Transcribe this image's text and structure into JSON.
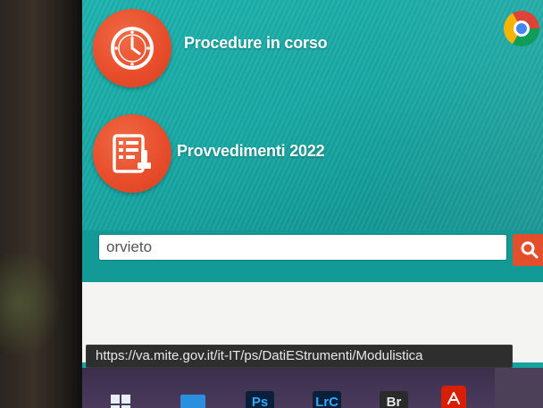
{
  "menu": {
    "items": [
      {
        "label": "Procedure in corso",
        "icon": "clock-icon"
      },
      {
        "label": "Provvedimenti 2022",
        "icon": "document-stamp-icon"
      }
    ]
  },
  "search": {
    "value": "orvieto",
    "button_icon": "search-icon"
  },
  "status_bar": {
    "url": "https://va.mite.gov.it/it-IT/ps/DatiEStrumenti/Modulistica"
  },
  "taskbar": {
    "apps": [
      {
        "name": "windows-start",
        "label": ""
      },
      {
        "name": "file-explorer",
        "label": ""
      },
      {
        "name": "photoshop",
        "label": "Ps"
      },
      {
        "name": "lightroom-classic",
        "label": "LrC"
      },
      {
        "name": "bridge",
        "label": "Br"
      },
      {
        "name": "acrobat",
        "label": ""
      },
      {
        "name": "chrome",
        "label": ""
      }
    ]
  },
  "colors": {
    "teal": "#18a8a4",
    "accent": "#e84e2c",
    "status_bg": "#2e2e2e"
  }
}
